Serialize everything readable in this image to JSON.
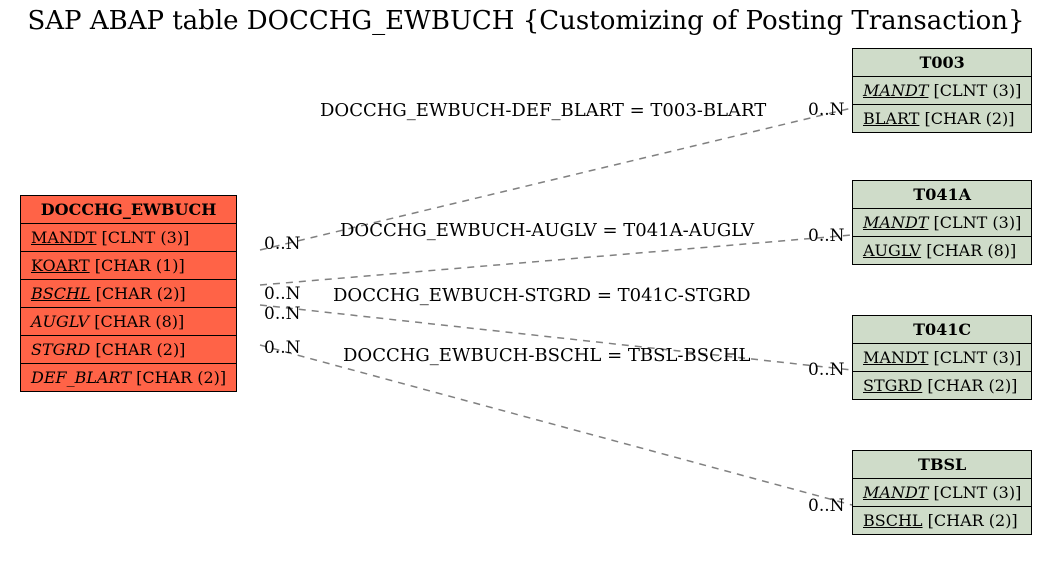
{
  "title": "SAP ABAP table DOCCHG_EWBUCH {Customizing of Posting Transaction}",
  "main_entity": {
    "name": "DOCCHG_EWBUCH",
    "fields": [
      {
        "name": "MANDT",
        "type": "[CLNT (3)]",
        "key": true,
        "ital": false
      },
      {
        "name": "KOART",
        "type": "[CHAR (1)]",
        "key": true,
        "ital": false
      },
      {
        "name": "BSCHL",
        "type": "[CHAR (2)]",
        "key": true,
        "ital": true
      },
      {
        "name": "AUGLV",
        "type": "[CHAR (8)]",
        "key": false,
        "ital": true
      },
      {
        "name": "STGRD",
        "type": "[CHAR (2)]",
        "key": false,
        "ital": true
      },
      {
        "name": "DEF_BLART",
        "type": "[CHAR (2)]",
        "key": false,
        "ital": true
      }
    ]
  },
  "ref_entities": [
    {
      "name": "T003",
      "fields": [
        {
          "name": "MANDT",
          "type": "[CLNT (3)]",
          "key": true,
          "ital": true
        },
        {
          "name": "BLART",
          "type": "[CHAR (2)]",
          "key": true,
          "ital": false
        }
      ]
    },
    {
      "name": "T041A",
      "fields": [
        {
          "name": "MANDT",
          "type": "[CLNT (3)]",
          "key": true,
          "ital": true
        },
        {
          "name": "AUGLV",
          "type": "[CHAR (8)]",
          "key": true,
          "ital": false
        }
      ]
    },
    {
      "name": "T041C",
      "fields": [
        {
          "name": "MANDT",
          "type": "[CLNT (3)]",
          "key": true,
          "ital": false
        },
        {
          "name": "STGRD",
          "type": "[CHAR (2)]",
          "key": true,
          "ital": false
        }
      ]
    },
    {
      "name": "TBSL",
      "fields": [
        {
          "name": "MANDT",
          "type": "[CLNT (3)]",
          "key": true,
          "ital": true
        },
        {
          "name": "BSCHL",
          "type": "[CHAR (2)]",
          "key": true,
          "ital": false
        }
      ]
    }
  ],
  "relations": [
    {
      "label": "DOCCHG_EWBUCH-DEF_BLART = T003-BLART",
      "left_card": "0..N",
      "right_card": "0..N"
    },
    {
      "label": "DOCCHG_EWBUCH-AUGLV = T041A-AUGLV",
      "left_card": "0..N",
      "right_card": "0..N"
    },
    {
      "label": "DOCCHG_EWBUCH-STGRD = T041C-STGRD",
      "left_card": "0..N",
      "right_card": ""
    },
    {
      "label": "DOCCHG_EWBUCH-BSCHL = TBSL-BSCHL",
      "left_card": "0..N",
      "right_card": "0..N"
    }
  ],
  "extra_cards": {
    "t041c_right": "0..N"
  },
  "colors": {
    "main_bg": "#ff6347",
    "ref_bg": "#cfdcc9",
    "line": "#808080"
  }
}
